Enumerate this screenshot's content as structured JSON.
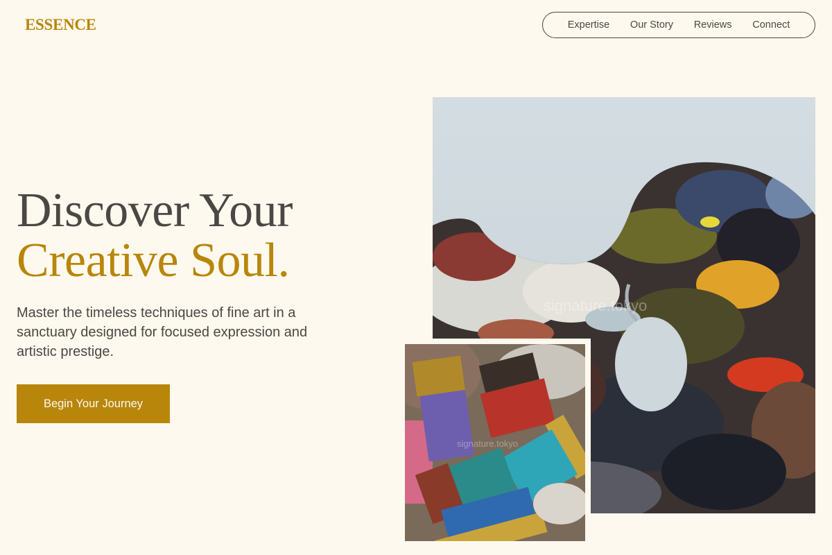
{
  "brand": {
    "logo": "ESSENCE",
    "accent_color": "#b8860b",
    "background_color": "#fef9ee",
    "text_color": "#4a4744"
  },
  "nav": {
    "items": [
      {
        "label": "Expertise"
      },
      {
        "label": "Our Story"
      },
      {
        "label": "Reviews"
      },
      {
        "label": "Connect"
      }
    ]
  },
  "hero": {
    "title_line1": "Discover Your",
    "title_line2": "Creative Soul.",
    "description": "Master the timeless techniques of fine art in a sanctuary designed for focused expression and artistic prestige.",
    "cta_label": "Begin Your Journey"
  },
  "images": {
    "palette": {
      "subject": "paint-covered artist palette",
      "watermark": "signature.tokyo"
    },
    "brushes": {
      "subject": "paint brushes with colorful paint",
      "watermark": "signature.tokyo"
    }
  }
}
